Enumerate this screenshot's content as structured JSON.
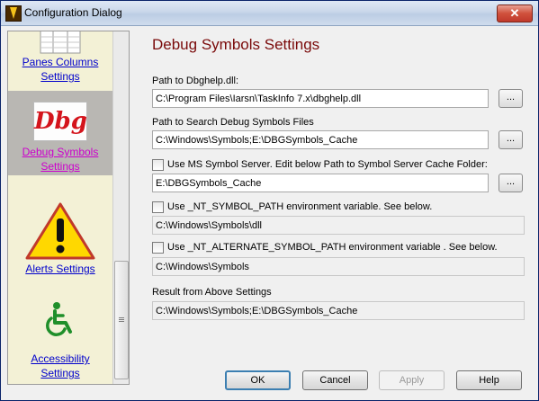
{
  "window": {
    "title": "Configuration Dialog",
    "close_glyph": "✕"
  },
  "sidebar": {
    "items": [
      {
        "label": "Panes Columns Settings",
        "icon": "panes-columns-icon",
        "selected": false
      },
      {
        "label": "Debug Symbols Settings",
        "icon": "dbg-icon",
        "icon_text": "Dbg",
        "selected": true
      },
      {
        "label": "Alerts Settings",
        "icon": "warning-icon",
        "selected": false
      },
      {
        "label": "Accessibility Settings",
        "icon": "wheelchair-icon",
        "selected": false
      }
    ]
  },
  "main": {
    "heading": "Debug Symbols Settings",
    "dbghelp": {
      "label": "Path to Dbghelp.dll:",
      "value": "C:\\Program Files\\Iarsn\\TaskInfo 7.x\\dbghelp.dll",
      "browse": "..."
    },
    "search_path": {
      "label": "Path to Search Debug Symbols Files",
      "value": "C:\\Windows\\Symbols;E:\\DBGSymbols_Cache",
      "browse": "..."
    },
    "ms_server": {
      "label": "Use MS Symbol Server. Edit below Path to Symbol Server Cache Folder:",
      "checked": false,
      "value": "E:\\DBGSymbols_Cache",
      "browse": "..."
    },
    "nt_symbol": {
      "label": "Use _NT_SYMBOL_PATH environment variable. See below.",
      "checked": false,
      "value": "C:\\Windows\\Symbols\\dll"
    },
    "nt_alt_symbol": {
      "label": "Use _NT_ALTERNATE_SYMBOL_PATH environment variable . See below.",
      "checked": false,
      "value": "C:\\Windows\\Symbols"
    },
    "result": {
      "label": "Result from Above Settings",
      "value": "C:\\Windows\\Symbols;E:\\DBGSymbols_Cache"
    }
  },
  "buttons": {
    "ok": "OK",
    "cancel": "Cancel",
    "apply": "Apply",
    "help": "Help"
  },
  "colors": {
    "heading": "#7a0a0a",
    "link": "#0000cc",
    "selected_link": "#cc00cc",
    "dbg_text": "#d4141c",
    "warning_fill": "#ffd800"
  }
}
